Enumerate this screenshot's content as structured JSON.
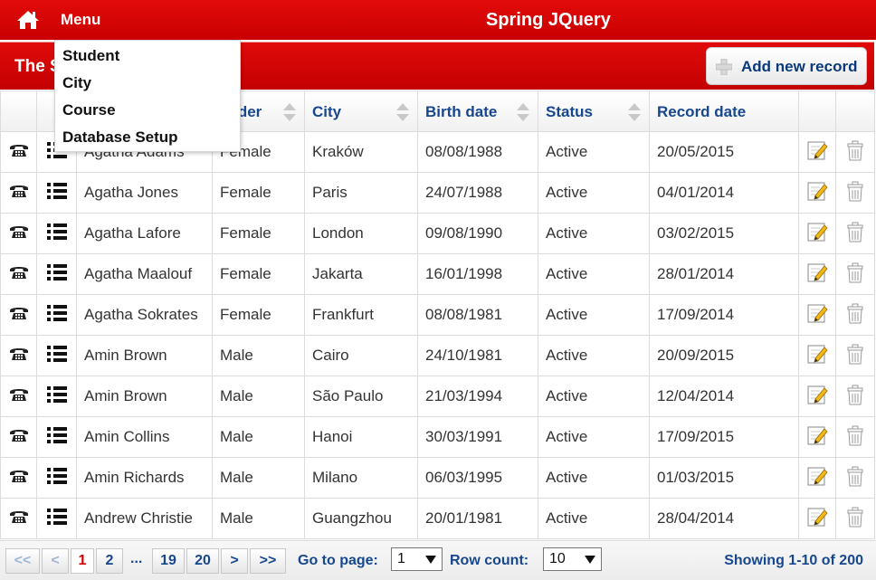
{
  "header": {
    "menu_label": "Menu",
    "app_title": "Spring JQuery"
  },
  "menu": {
    "items": [
      "Student",
      "City",
      "Course",
      "Database Setup"
    ]
  },
  "table": {
    "title_partial": "The S",
    "add_button_label": "Add new record",
    "columns": [
      "",
      "",
      "",
      "ender",
      "City",
      "Birth date",
      "Status",
      "Record date",
      "",
      ""
    ],
    "rows": [
      {
        "name": "Agatha Adams",
        "gender": "Female",
        "city": "Kraków",
        "birth_date": "08/08/1988",
        "status": "Active",
        "record_date": "20/05/2015"
      },
      {
        "name": "Agatha Jones",
        "gender": "Female",
        "city": "Paris",
        "birth_date": "24/07/1988",
        "status": "Active",
        "record_date": "04/01/2014"
      },
      {
        "name": "Agatha Lafore",
        "gender": "Female",
        "city": "London",
        "birth_date": "09/08/1990",
        "status": "Active",
        "record_date": "03/02/2015"
      },
      {
        "name": "Agatha Maalouf",
        "gender": "Female",
        "city": "Jakarta",
        "birth_date": "16/01/1998",
        "status": "Active",
        "record_date": "28/01/2014"
      },
      {
        "name": "Agatha Sokrates",
        "gender": "Female",
        "city": "Frankfurt",
        "birth_date": "08/08/1981",
        "status": "Active",
        "record_date": "17/09/2014"
      },
      {
        "name": "Amin Brown",
        "gender": "Male",
        "city": "Cairo",
        "birth_date": "24/10/1981",
        "status": "Active",
        "record_date": "20/09/2015"
      },
      {
        "name": "Amin Brown",
        "gender": "Male",
        "city": "São Paulo",
        "birth_date": "21/03/1994",
        "status": "Active",
        "record_date": "12/04/2014"
      },
      {
        "name": "Amin Collins",
        "gender": "Male",
        "city": "Hanoi",
        "birth_date": "30/03/1991",
        "status": "Active",
        "record_date": "17/09/2015"
      },
      {
        "name": "Amin Richards",
        "gender": "Male",
        "city": "Milano",
        "birth_date": "06/03/1995",
        "status": "Active",
        "record_date": "01/03/2015"
      },
      {
        "name": "Andrew Christie",
        "gender": "Male",
        "city": "Guangzhou",
        "birth_date": "20/01/1981",
        "status": "Active",
        "record_date": "28/04/2014"
      }
    ]
  },
  "pager": {
    "first": "<<",
    "prev": "<",
    "pages": [
      "1",
      "2"
    ],
    "ellipsis": "...",
    "late_pages": [
      "19",
      "20"
    ],
    "next": ">",
    "last": ">>",
    "goto_label": "Go to page:",
    "goto_value": "1",
    "rowcount_label": "Row count:",
    "rowcount_value": "10",
    "showing": "Showing 1-10 of 200"
  },
  "colors": {
    "brand_red": "#d40000",
    "link_blue": "#17478e"
  },
  "icons": {
    "row_icons": [
      "phone-icon",
      "list-icon"
    ],
    "action_icons": [
      "edit-icon",
      "delete-icon"
    ]
  }
}
